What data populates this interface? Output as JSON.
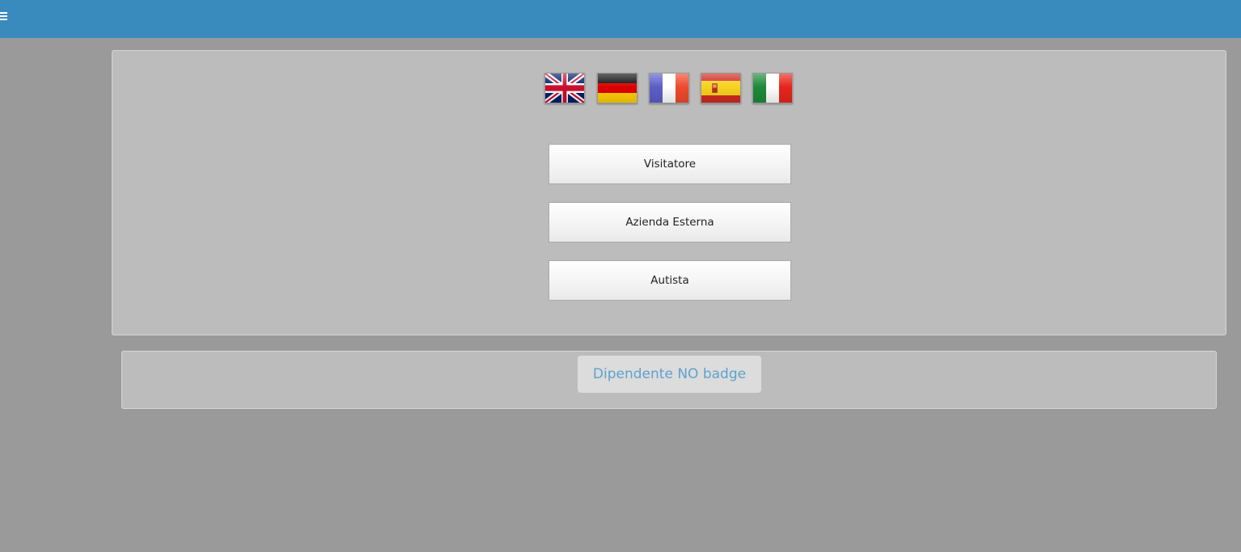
{
  "header": {
    "menu_icon": "hamburger-menu-icon",
    "background_color": "#3a8bbd"
  },
  "languages": [
    {
      "code": "en",
      "icon": "uk-flag-icon"
    },
    {
      "code": "de",
      "icon": "germany-flag-icon"
    },
    {
      "code": "fr",
      "icon": "france-flag-icon"
    },
    {
      "code": "es",
      "icon": "spain-flag-icon"
    },
    {
      "code": "it",
      "icon": "italy-flag-icon"
    }
  ],
  "actions": {
    "visitor_label": "Visitatore",
    "company_label": "Azienda Esterna",
    "driver_label": "Autista"
  },
  "employee": {
    "label": "Dipendente NO badge",
    "text_color": "#5da2cf"
  }
}
